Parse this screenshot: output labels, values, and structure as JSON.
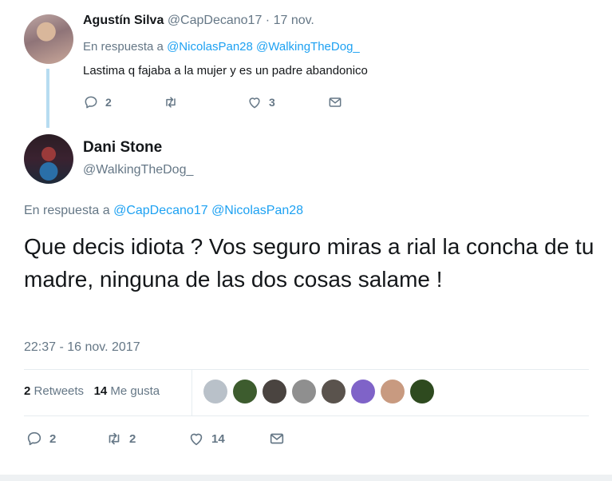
{
  "reply_tweet": {
    "name": "Agustín Silva",
    "handle_date": "@CapDecano17 · 17 nov.",
    "in_reply_prefix": "En respuesta a",
    "in_reply_mentions": "@NicolasPan28 @WalkingTheDog_",
    "text": "Lastima q fajaba a la mujer y es un padre abandonico",
    "replies": "2",
    "retweets": "",
    "likes": "3"
  },
  "main_tweet": {
    "name": "Dani Stone",
    "handle": "@WalkingTheDog_",
    "in_reply_prefix": "En respuesta a",
    "in_reply_mentions": "@CapDecano17 @NicolasPan28",
    "text": "Que decis idiota ? Vos seguro miras a rial la concha de tu madre, ninguna de las dos cosas salame !",
    "timestamp": "22:37 - 16 nov. 2017",
    "retweet_count": "2",
    "retweet_label": "Retweets",
    "like_count": "14",
    "like_label": "Me gusta",
    "liker_colors": [
      "#b9c1c9",
      "#3d5c2e",
      "#4a4440",
      "#8f8f8f",
      "#5a534d",
      "#7f63c8",
      "#c89a80",
      "#2e4a1f"
    ],
    "actions": {
      "replies": "2",
      "retweets": "2",
      "likes": "14"
    }
  },
  "icons": [
    "reply-icon",
    "retweet-icon",
    "like-icon",
    "direct-message-icon"
  ],
  "colors": {
    "link": "#1da1f2",
    "meta": "#657786",
    "text": "#14171a",
    "thread_line": "#b7dcf1"
  }
}
